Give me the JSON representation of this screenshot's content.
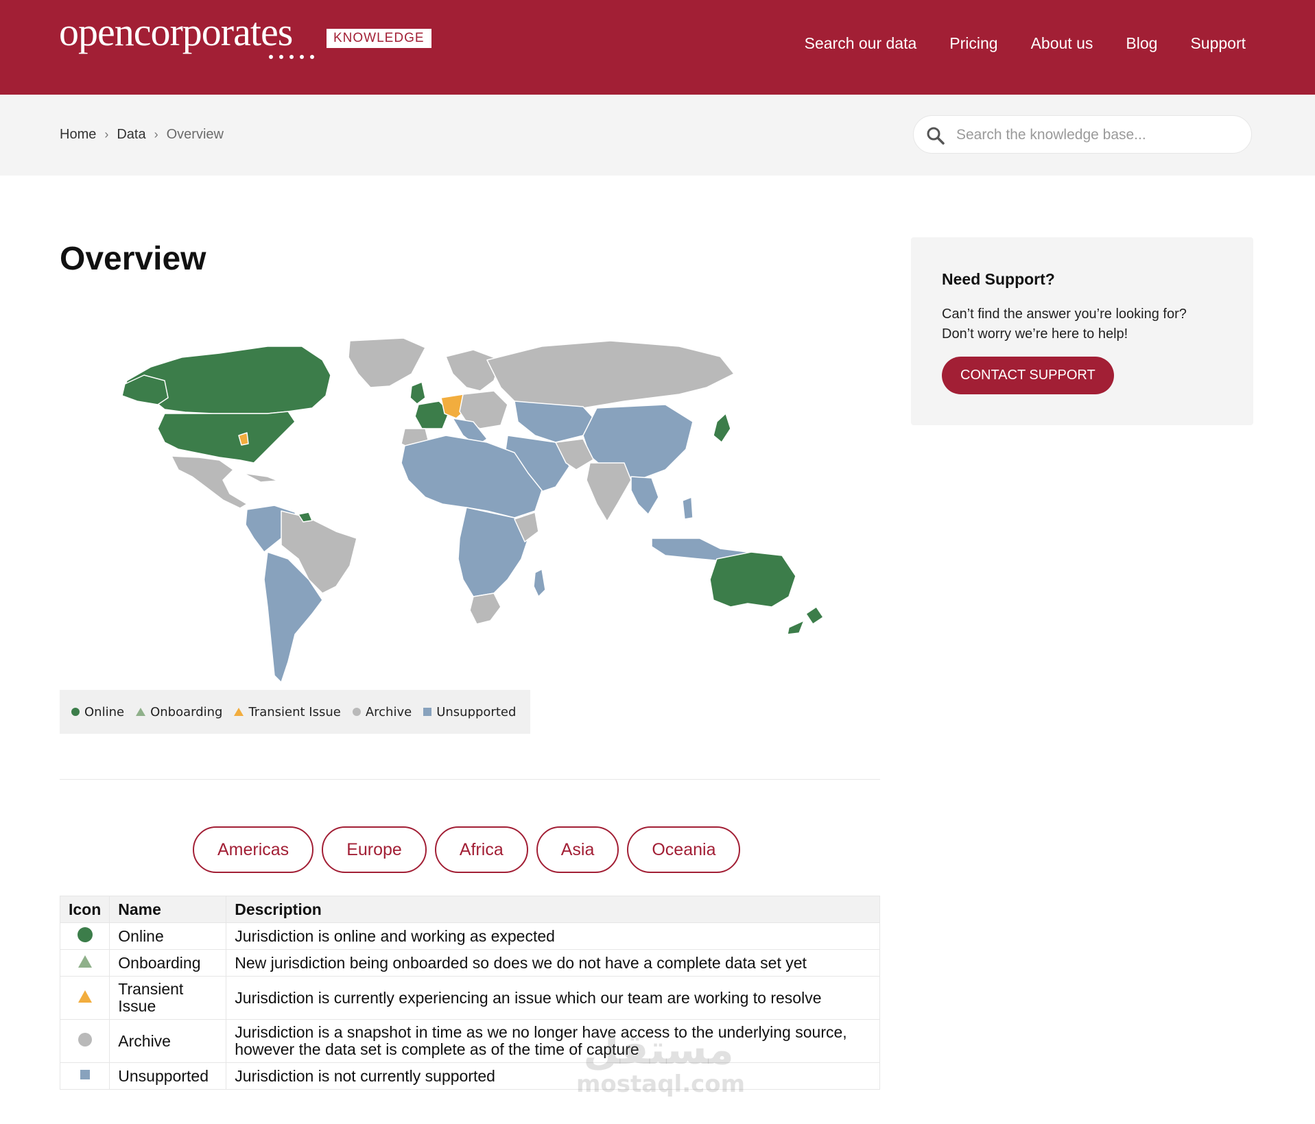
{
  "brand": {
    "name": "opencorporates",
    "badge": "KNOWLEDGE"
  },
  "nav": {
    "items": [
      {
        "label": "Search our data"
      },
      {
        "label": "Pricing"
      },
      {
        "label": "About us"
      },
      {
        "label": "Blog"
      },
      {
        "label": "Support"
      }
    ]
  },
  "breadcrumb": {
    "home": "Home",
    "data": "Data",
    "current": "Overview"
  },
  "search": {
    "placeholder": "Search the knowledge base...",
    "value": ""
  },
  "page": {
    "title": "Overview"
  },
  "map": {
    "legend": [
      {
        "label": "Online",
        "color": "#3c7d4a",
        "icon": "circle"
      },
      {
        "label": "Onboarding",
        "color": "#8fb08a",
        "icon": "triangle"
      },
      {
        "label": "Transient Issue",
        "color": "#f2ad3e",
        "icon": "triangle"
      },
      {
        "label": "Archive",
        "color": "#b9b9b9",
        "icon": "circle"
      },
      {
        "label": "Unsupported",
        "color": "#88a2bd",
        "icon": "square"
      }
    ]
  },
  "regions": [
    {
      "label": "Americas"
    },
    {
      "label": "Europe"
    },
    {
      "label": "Africa"
    },
    {
      "label": "Asia"
    },
    {
      "label": "Oceania"
    }
  ],
  "table": {
    "headers": [
      "Icon",
      "Name",
      "Description"
    ],
    "rows": [
      {
        "icon": "circle",
        "color": "#3c7d4a",
        "name": "Online",
        "description": "Jurisdiction is online and working as expected"
      },
      {
        "icon": "triangle",
        "color": "#8fb08a",
        "name": "Onboarding",
        "description": "New jurisdiction being onboarded so does we do not have a complete data set yet"
      },
      {
        "icon": "triangle",
        "color": "#f2ad3e",
        "name": "Transient Issue",
        "description": "Jurisdiction is currently experiencing an issue which our team are working to resolve"
      },
      {
        "icon": "circle",
        "color": "#b9b9b9",
        "name": "Archive",
        "description": "Jurisdiction is a snapshot in time as we no longer have access to the underlying source, however the data set is complete as of the time of capture"
      },
      {
        "icon": "square",
        "color": "#88a2bd",
        "name": "Unsupported",
        "description": "Jurisdiction is not currently supported"
      }
    ]
  },
  "support": {
    "heading": "Need Support?",
    "line1": "Can’t find the answer you’re looking for?",
    "line2": "Don’t worry we’re here to help!",
    "button": "CONTACT SUPPORT"
  },
  "watermark": {
    "arabic": "مستقل",
    "latin": "mostaql.com"
  },
  "colors": {
    "brand": "#a21f35",
    "online": "#3c7d4a",
    "archive": "#b9b9b9",
    "unsupported": "#88a2bd",
    "transient": "#f2ad3e",
    "onboarding": "#8fb08a"
  }
}
